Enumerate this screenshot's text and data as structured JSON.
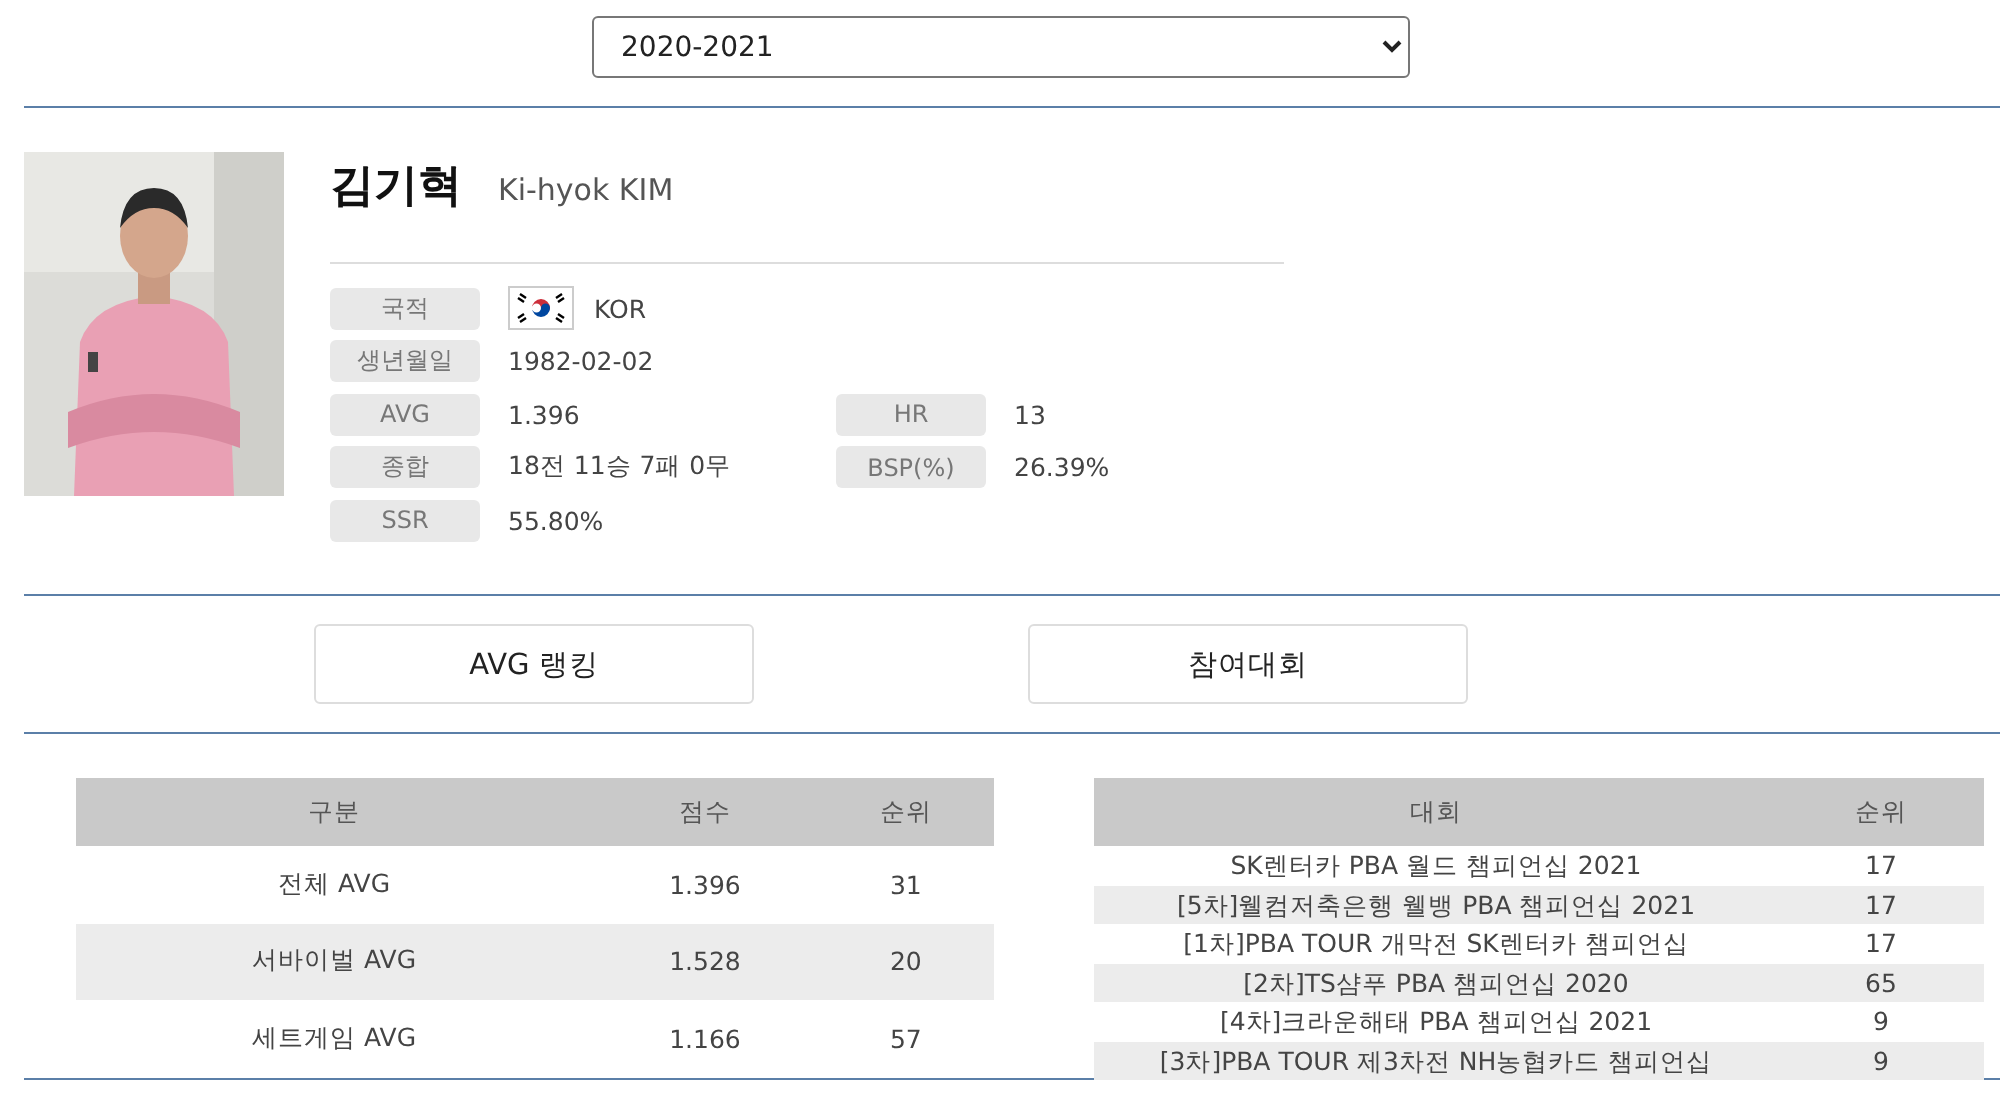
{
  "season_select": {
    "value": "2020-2021"
  },
  "player": {
    "name_ko": "김기혁",
    "name_en": "Ki-hyok KIM",
    "info": [
      {
        "label": "국적",
        "value": "KOR",
        "kind": "flag"
      },
      {
        "label": "생년월일",
        "value": "1982-02-02",
        "kind": "text"
      },
      {
        "label": "AVG",
        "value": "1.396",
        "kind": "text",
        "extra_label": "HR",
        "extra_value": "13"
      },
      {
        "label": "종합",
        "value": "18전 11승 7패 0무",
        "kind": "text",
        "extra_label": "BSP(%)",
        "extra_value": "26.39%"
      },
      {
        "label": "SSR",
        "value": "55.80%",
        "kind": "text"
      }
    ]
  },
  "buttons": [
    "AVG 랭킹",
    "참여대회"
  ],
  "avg_table": {
    "columns": [
      "구분",
      "점수",
      "순위"
    ],
    "rows": [
      [
        "전체 AVG",
        "1.396",
        "31"
      ],
      [
        "서바이벌 AVG",
        "1.528",
        "20"
      ],
      [
        "세트게임 AVG",
        "1.166",
        "57"
      ]
    ]
  },
  "tournament_table": {
    "columns": [
      "대회",
      "순위"
    ],
    "rows": [
      [
        "SK렌터카 PBA 월드 챔피언십 2021",
        "17"
      ],
      [
        "[5차]웰컴저축은행 웰뱅 PBA 챔피언십 2021",
        "17"
      ],
      [
        "[1차]PBA TOUR 개막전 SK렌터카 챔피언십",
        "17"
      ],
      [
        "[2차]TS샴푸 PBA 챔피언십 2020",
        "65"
      ],
      [
        "[4차]크라운해태 PBA 챔피언십 2021",
        "9"
      ],
      [
        "[3차]PBA TOUR 제3차전 NH농협카드 챔피언십",
        "9"
      ]
    ]
  }
}
